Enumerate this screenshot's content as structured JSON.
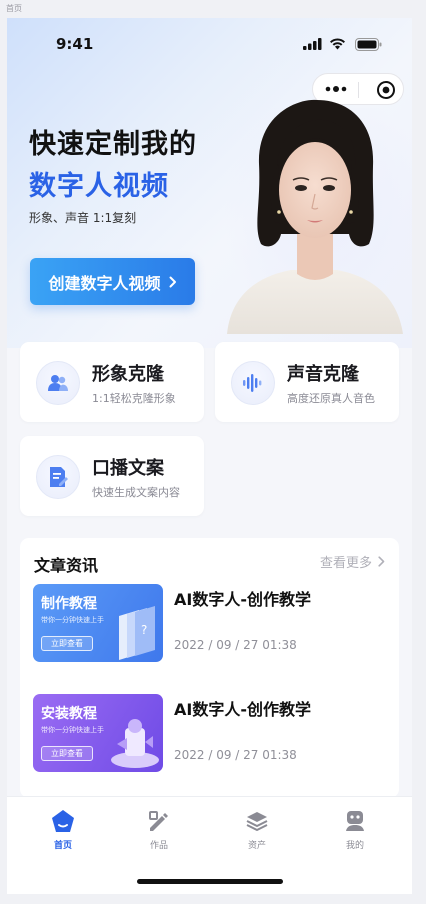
{
  "frame_label": "首页",
  "status_bar": {
    "time": "9:41"
  },
  "hero": {
    "headline_line1": "快速定制我的",
    "headline_line2": "数字人视频",
    "subline": "形象、声音 1:1复刻",
    "cta_label": "创建数字人视频"
  },
  "features": [
    {
      "title": "形象克隆",
      "subtitle": "1:1轻松克隆形象",
      "icon": "user-clone-icon"
    },
    {
      "title": "声音克隆",
      "subtitle": "高度还原真人音色",
      "icon": "sound-wave-icon"
    },
    {
      "title": "口播文案",
      "subtitle": "快速生成文案内容",
      "icon": "document-edit-icon"
    }
  ],
  "articles": {
    "section_title": "文章资讯",
    "see_more": "查看更多",
    "items": [
      {
        "thumb_title": "制作教程",
        "thumb_subtitle": "带你一分钟快速上手",
        "thumb_button": "立即查看",
        "title": "AI数字人-创作教学",
        "date": "2022 / 09 / 27 01:38"
      },
      {
        "thumb_title": "安装教程",
        "thumb_subtitle": "带你一分钟快速上手",
        "thumb_button": "立即查看",
        "title": "AI数字人-创作教学",
        "date": "2022 / 09 / 27 01:38"
      }
    ]
  },
  "tabbar": [
    {
      "label": "首页",
      "icon": "home-icon",
      "active": true
    },
    {
      "label": "作品",
      "icon": "works-icon",
      "active": false
    },
    {
      "label": "资产",
      "icon": "assets-icon",
      "active": false
    },
    {
      "label": "我的",
      "icon": "profile-icon",
      "active": false
    }
  ],
  "colors": {
    "accent": "#2a62e6",
    "cta_gradient_start": "#3aa3f5",
    "cta_gradient_end": "#2a7be8",
    "thumb_blue": "#4f8df5",
    "thumb_purple": "#8a5cf0"
  }
}
